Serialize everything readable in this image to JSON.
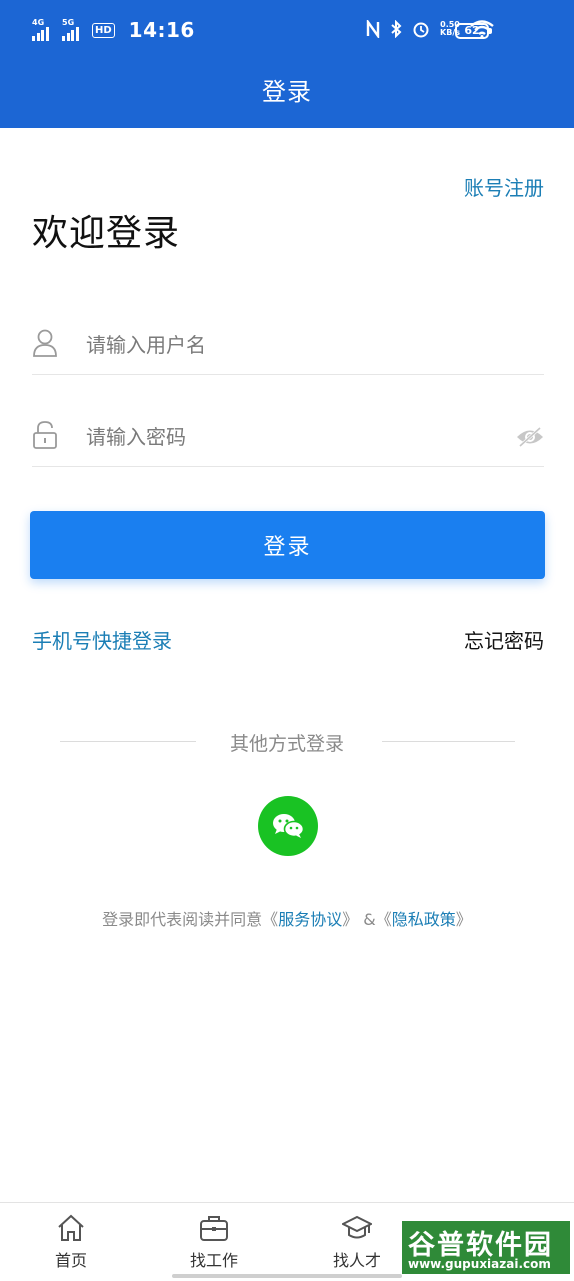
{
  "status_bar": {
    "signal1_label": "4G",
    "signal2_label": "5G",
    "hd_label": "HD",
    "time": "14:16",
    "net_speed_value": "0.50",
    "net_speed_unit": "KB/s",
    "battery": "62"
  },
  "header": {
    "title": "登录"
  },
  "register_link": "账号注册",
  "welcome_title": "欢迎登录",
  "username_field": {
    "placeholder": "请输入用户名",
    "value": "",
    "icon": "user-icon"
  },
  "password_field": {
    "placeholder": "请输入密码",
    "value": "",
    "icon": "lock-icon",
    "toggle_icon": "eye-hidden-icon"
  },
  "login_button": "登录",
  "quick_login_link": "手机号快捷登录",
  "forgot_password_link": "忘记密码",
  "other_login_label": "其他方式登录",
  "wechat_login_icon": "wechat-icon",
  "agreement": {
    "prefix": "登录即代表阅读并同意《",
    "service_link": "服务协议",
    "middle": "》 &《",
    "privacy_link": "隐私政策",
    "suffix": "》"
  },
  "tab_bar": {
    "tabs": [
      {
        "label": "首页",
        "icon": "home-icon"
      },
      {
        "label": "找工作",
        "icon": "briefcase-icon"
      },
      {
        "label": "找人才",
        "icon": "graduation-cap-icon"
      }
    ]
  },
  "watermark": {
    "title": "谷普软件园",
    "url": "www.gupuxiazai.com"
  },
  "colors": {
    "primary": "#1c66d4",
    "button": "#1a7ff0",
    "link": "#1b7eb5",
    "wechat": "#19c223"
  }
}
